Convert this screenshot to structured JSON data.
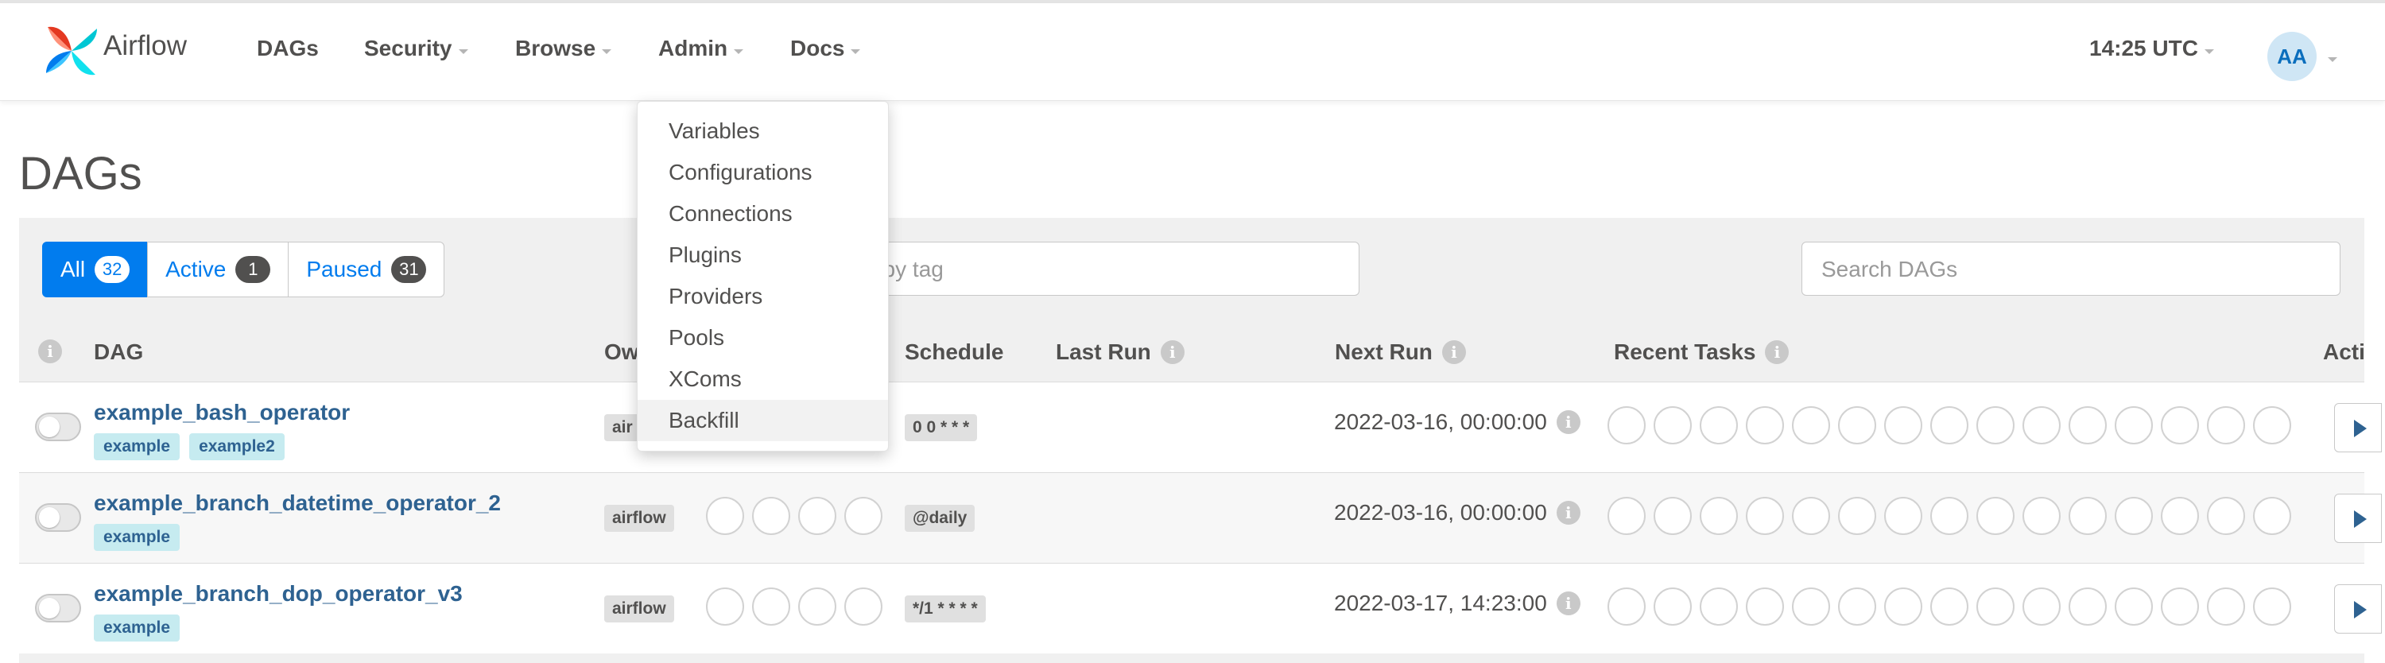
{
  "navbar": {
    "brand": "Airflow",
    "items": [
      {
        "label": "DAGs",
        "dropdown": false
      },
      {
        "label": "Security",
        "dropdown": true
      },
      {
        "label": "Browse",
        "dropdown": true
      },
      {
        "label": "Admin",
        "dropdown": true
      },
      {
        "label": "Docs",
        "dropdown": true
      }
    ],
    "clock": "14:25 UTC",
    "avatar": "AA"
  },
  "admin_menu": {
    "items": [
      "Variables",
      "Configurations",
      "Connections",
      "Plugins",
      "Providers",
      "Pools",
      "XComs",
      "Backfill"
    ],
    "highlighted": "Backfill"
  },
  "page": {
    "title": "DAGs"
  },
  "filters": {
    "all": {
      "label": "All",
      "count": "32"
    },
    "active": {
      "label": "Active",
      "count": "1"
    },
    "paused": {
      "label": "Paused",
      "count": "31"
    },
    "tag_placeholder": "r DAGs by tag",
    "search_placeholder": "Search DAGs"
  },
  "table": {
    "headers": {
      "dag": "DAG",
      "owner": "Ow",
      "schedule": "Schedule",
      "last_run": "Last Run",
      "next_run": "Next Run",
      "recent_tasks": "Recent Tasks",
      "actions": "Acti"
    },
    "info_glyph": "i",
    "rows": [
      {
        "name": "example_bash_operator",
        "tags": [
          "example",
          "example2"
        ],
        "owner": "air",
        "schedule": "0 0 * * *",
        "next_run": "2022-03-16, 00:00:00"
      },
      {
        "name": "example_branch_datetime_operator_2",
        "tags": [
          "example"
        ],
        "owner": "airflow",
        "schedule": "@daily",
        "next_run": "2022-03-16, 00:00:00"
      },
      {
        "name": "example_branch_dop_operator_v3",
        "tags": [
          "example"
        ],
        "owner": "airflow",
        "schedule": "*/1 * * * *",
        "next_run": "2022-03-17, 14:23:00"
      }
    ]
  },
  "colors": {
    "accent": "#017cee",
    "link": "#2e6291",
    "tag_bg": "#c6ebf0",
    "text": "#51504f"
  }
}
